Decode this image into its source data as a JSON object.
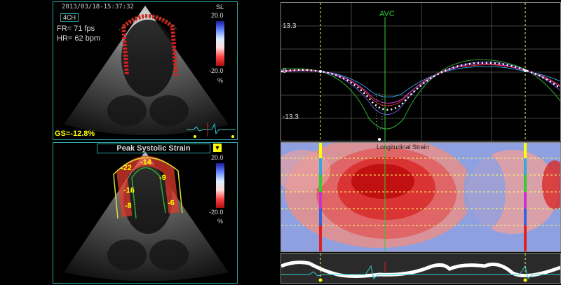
{
  "top_panel": {
    "timestamp": "2013/03/18-15:37:32",
    "view_tag": "4CH",
    "frame_rate": "FR= 71 fps",
    "heart_rate": "HR= 62 bpm",
    "scale_mode": "SL",
    "scale_max": "20.0",
    "scale_min": "-20.0",
    "scale_unit": "%",
    "global_strain": "GS=-12.8%"
  },
  "bottom_panel": {
    "title": "Peak Systolic Strain",
    "scale_max": "20.0",
    "scale_min": "-20.0",
    "scale_unit": "%",
    "segment_values": [
      "-14",
      "-22",
      "-9",
      "-16",
      "-6",
      "-8"
    ]
  },
  "curve_chart": {
    "event_label": "AVC",
    "y_top": "13.3",
    "y_zero": "0",
    "y_bottom": "-13.3"
  },
  "map_chart": {
    "title": "Longitudinal Strain"
  },
  "colors": {
    "panel_border": "#2fa3a3",
    "global_strain": "#ffff00",
    "avc_line": "#33cc33",
    "event_line": "#ffff66",
    "strain_negative": "#dd2222",
    "strain_positive": "#3366dd"
  }
}
